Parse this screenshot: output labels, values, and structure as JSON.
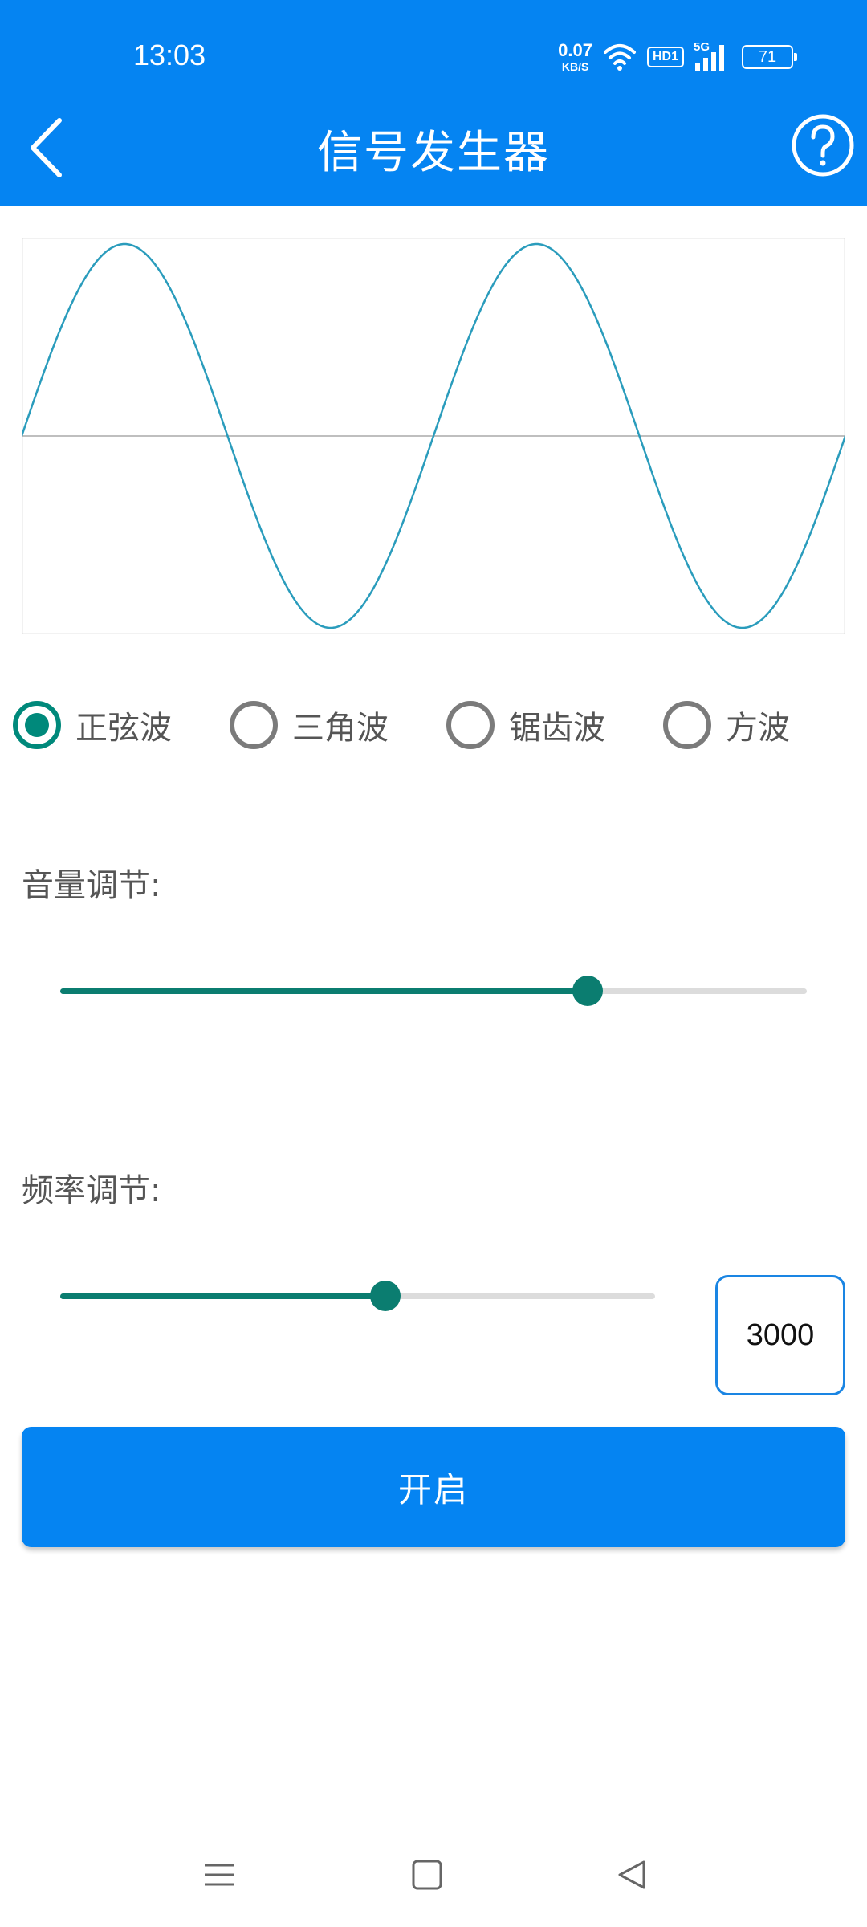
{
  "status_bar": {
    "time": "13:03",
    "net_speed_value": "0.07",
    "net_speed_unit": "KB/S",
    "hd_badge": "HD1",
    "signal_label": "5G",
    "battery": "71",
    "icons": [
      "wifi-icon",
      "signal-icon",
      "battery-icon"
    ]
  },
  "app_bar": {
    "title": "信号发生器",
    "back_icon": "chevron-left-icon",
    "help_icon": "help-circle-icon",
    "background_color": "#0584f2"
  },
  "chart_data": {
    "type": "line",
    "series": [
      {
        "waveform": "sine",
        "cycles": 2,
        "amplitude": 1,
        "color": "#2a9cbc"
      }
    ],
    "ylim": [
      -1.05,
      1.05
    ],
    "zero_line": true,
    "grid": false
  },
  "waveform_options": {
    "selected_index": 0,
    "items": [
      {
        "label": "正弦波"
      },
      {
        "label": "三角波"
      },
      {
        "label": "锯齿波"
      },
      {
        "label": "方波"
      }
    ]
  },
  "volume": {
    "label": "音量调节:",
    "value_fraction": 0.706
  },
  "frequency": {
    "label": "频率调节:",
    "value_fraction": 0.546,
    "input_value": "3000"
  },
  "start_button": {
    "label": "开启"
  },
  "colors": {
    "accent": "#0584f2",
    "slider_active": "#0b7d70",
    "radio_checked": "#00897b",
    "wave": "#2a9cbc"
  },
  "nav_bar": {
    "icons": [
      "menu-icon",
      "home-square-icon",
      "back-triangle-icon"
    ]
  }
}
